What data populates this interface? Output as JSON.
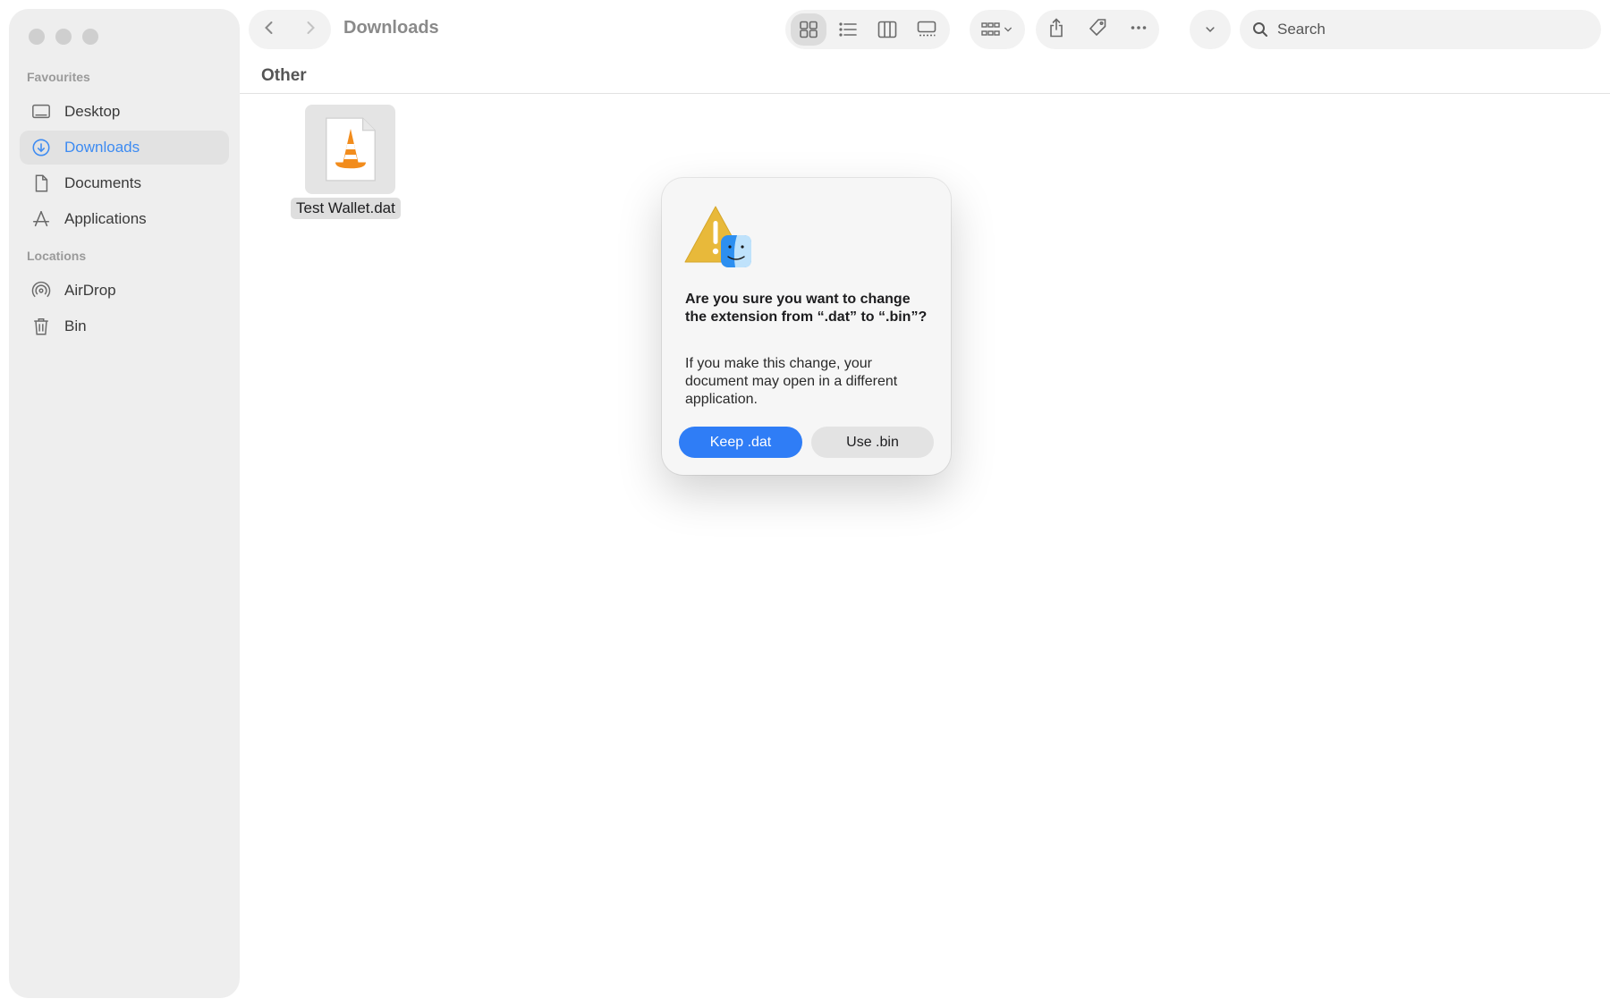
{
  "window": {
    "title": "Downloads"
  },
  "sidebar": {
    "sections": [
      {
        "label": "Favourites"
      },
      {
        "label": "Locations"
      }
    ],
    "favourites": [
      {
        "label": "Desktop",
        "icon": "desktop-icon"
      },
      {
        "label": "Downloads",
        "icon": "download-icon",
        "active": true
      },
      {
        "label": "Documents",
        "icon": "document-icon"
      },
      {
        "label": "Applications",
        "icon": "applications-icon"
      }
    ],
    "locations": [
      {
        "label": "AirDrop",
        "icon": "airdrop-icon"
      },
      {
        "label": "Bin",
        "icon": "trash-icon"
      }
    ]
  },
  "search": {
    "placeholder": "Search"
  },
  "content": {
    "section_header": "Other",
    "files": [
      {
        "name": "Test Wallet.dat",
        "icon": "vlc-cone-icon"
      }
    ]
  },
  "dialog": {
    "title": "Are you sure you want to change the extension from “.dat” to “.bin”?",
    "body": "If you make this change, your document may open in a different application.",
    "primary_label": "Keep .dat",
    "secondary_label": "Use .bin"
  },
  "colors": {
    "accent": "#2f7df6",
    "sidebar_active_text": "#3d8bf2",
    "sidebar_bg": "#eeeeee"
  }
}
